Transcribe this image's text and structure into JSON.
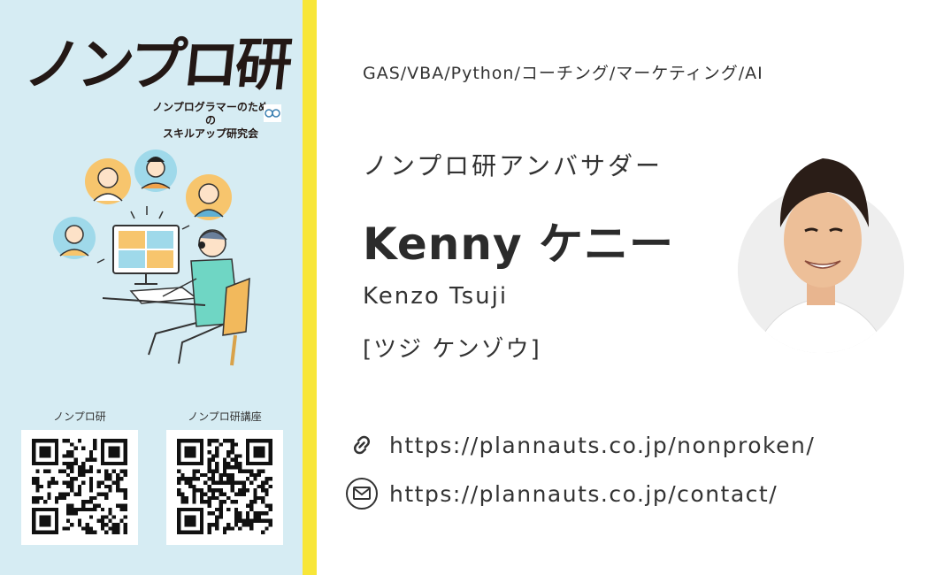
{
  "brand": {
    "logo_title": "ノンプロ研",
    "logo_subtitle_line1": "ノンプログラマーのための",
    "logo_subtitle_line2": "スキルアップ研究会"
  },
  "qr_codes": [
    {
      "label": "ノンプロ研"
    },
    {
      "label": "ノンプロ研講座"
    }
  ],
  "profile": {
    "skills": "GAS/VBA/Python/コーチング/マーケティング/AI",
    "role": "ノンプロ研アンバサダー",
    "name_display": "Kenny  ケニー",
    "name_roman": "Kenzo Tsuji",
    "name_kana": "[ツジ ケンゾウ]"
  },
  "links": [
    {
      "icon": "link-icon",
      "url": "https://plannauts.co.jp/nonproken/"
    },
    {
      "icon": "mail-icon",
      "url": "https://plannauts.co.jp/contact/"
    }
  ],
  "colors": {
    "left_panel": "#d6ecf3",
    "stripe": "#f8e638",
    "text": "#333333"
  }
}
